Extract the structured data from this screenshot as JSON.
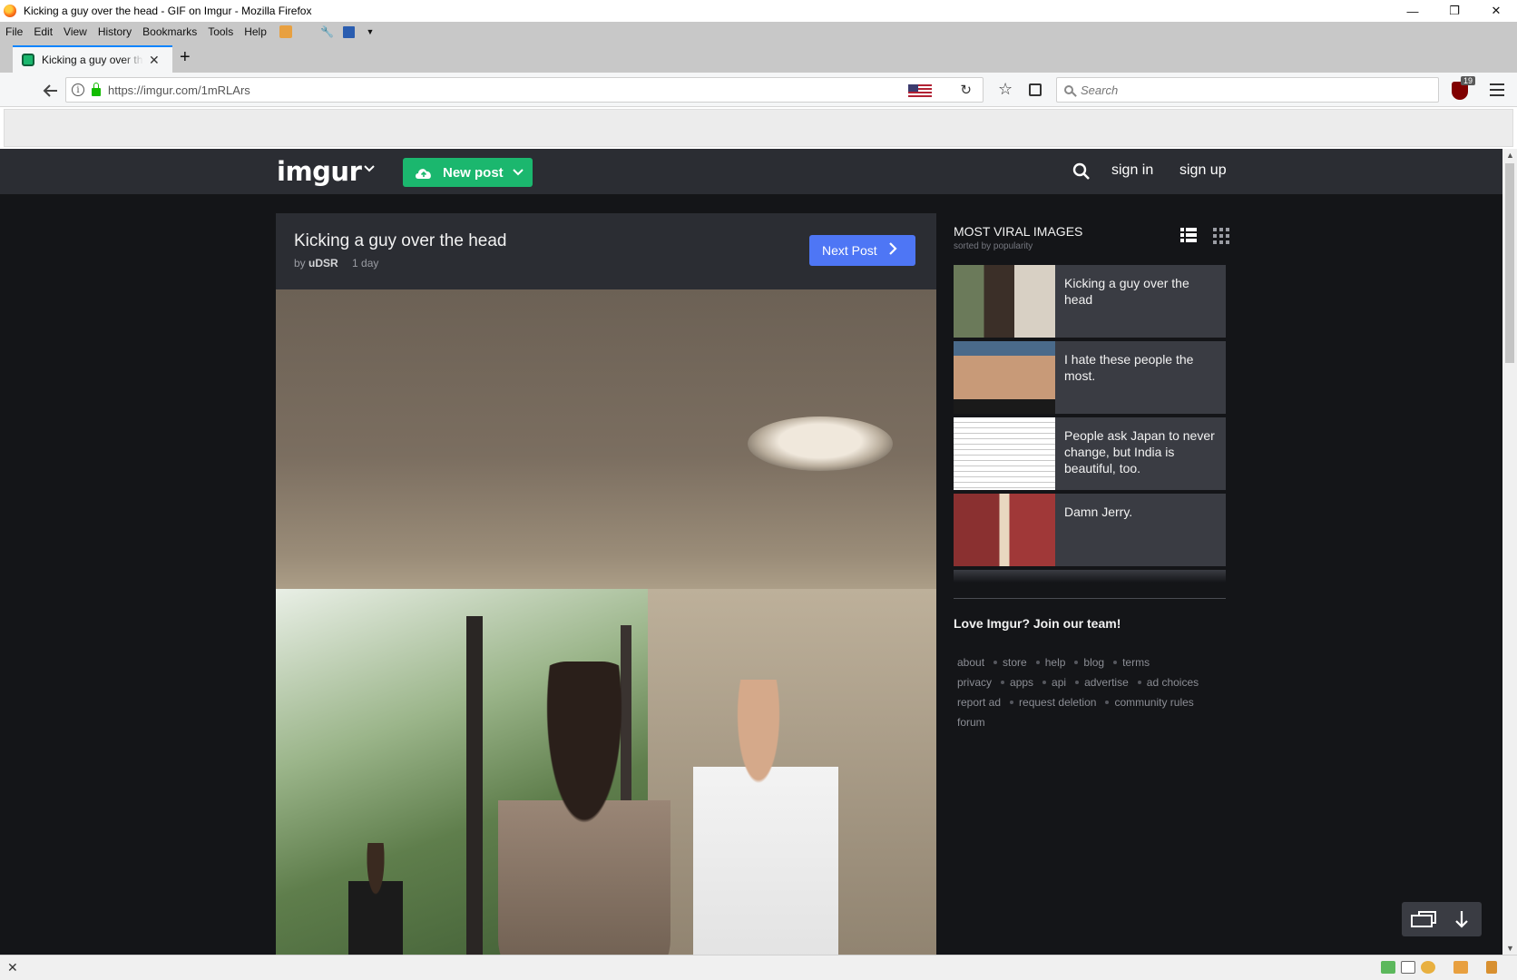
{
  "window": {
    "title": "Kicking a guy over the head - GIF on Imgur - Mozilla Firefox",
    "min_glyph": "—",
    "restore_glyph": "❐",
    "close_glyph": "✕"
  },
  "menubar": {
    "items": [
      "File",
      "Edit",
      "View",
      "History",
      "Bookmarks",
      "Tools",
      "Help"
    ]
  },
  "tab": {
    "label": "Kicking a guy over the head",
    "close_glyph": "✕",
    "new_tab_glyph": "+"
  },
  "navbar": {
    "url": "https://imgur.com/1mRLArs",
    "search_placeholder": "Search",
    "ublock_count": "19"
  },
  "imgur": {
    "logo": "imgur",
    "new_post_label": "New post",
    "sign_in": "sign in",
    "sign_up": "sign up"
  },
  "post": {
    "title": "Kicking a guy over the head",
    "by_prefix": "by",
    "author": "uDSR",
    "time": "1 day",
    "next_label": "Next Post"
  },
  "sidebar": {
    "heading": "MOST VIRAL IMAGES",
    "subheading": "sorted by popularity",
    "viral_items": [
      {
        "title": "Kicking a guy over the head"
      },
      {
        "title": "I hate these people the most."
      },
      {
        "title": "People ask Japan to never change, but India is beautiful, too."
      },
      {
        "title": "Damn Jerry."
      }
    ],
    "join_text": "Love Imgur? Join our team!",
    "footer_links": [
      [
        "about",
        "store",
        "help",
        "blog",
        "terms"
      ],
      [
        "privacy",
        "apps",
        "api",
        "advertise",
        "ad choices"
      ],
      [
        "report ad",
        "request deletion",
        "community rules"
      ],
      [
        "forum"
      ]
    ]
  },
  "colors": {
    "imgur_green": "#1bb76e",
    "next_blue": "#4e76f5",
    "page_bg": "#141518",
    "header_bg": "#2b2d33"
  }
}
